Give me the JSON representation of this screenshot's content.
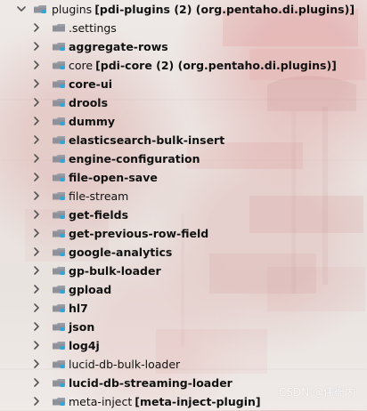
{
  "tree": {
    "root": {
      "name": "plugins",
      "suffix": "[pdi-plugins (2) (org.pentaho.di.plugins)]",
      "icon": "folder-icon",
      "expanded": true
    },
    "items": [
      {
        "name": ".settings",
        "suffix": "",
        "bold": false
      },
      {
        "name": "aggregate-rows",
        "suffix": "",
        "bold": true
      },
      {
        "name": "core",
        "suffix": "[pdi-core (2) (org.pentaho.di.plugins)]",
        "bold": false
      },
      {
        "name": "core-ui",
        "suffix": "",
        "bold": true
      },
      {
        "name": "drools",
        "suffix": "",
        "bold": true
      },
      {
        "name": "dummy",
        "suffix": "",
        "bold": true
      },
      {
        "name": "elasticsearch-bulk-insert",
        "suffix": "",
        "bold": true
      },
      {
        "name": "engine-configuration",
        "suffix": "",
        "bold": true
      },
      {
        "name": "file-open-save",
        "suffix": "",
        "bold": true
      },
      {
        "name": "file-stream",
        "suffix": "",
        "bold": false
      },
      {
        "name": "get-fields",
        "suffix": "",
        "bold": true
      },
      {
        "name": "get-previous-row-field",
        "suffix": "",
        "bold": true
      },
      {
        "name": "google-analytics",
        "suffix": "",
        "bold": true
      },
      {
        "name": "gp-bulk-loader",
        "suffix": "",
        "bold": true
      },
      {
        "name": "gpload",
        "suffix": "",
        "bold": true
      },
      {
        "name": "hl7",
        "suffix": "",
        "bold": true
      },
      {
        "name": "json",
        "suffix": "",
        "bold": true
      },
      {
        "name": "log4j",
        "suffix": "",
        "bold": true
      },
      {
        "name": "lucid-db-bulk-loader",
        "suffix": "",
        "bold": false
      },
      {
        "name": "lucid-db-streaming-loader",
        "suffix": "",
        "bold": true
      },
      {
        "name": "meta-inject",
        "suffix": "[meta-inject-plugin]",
        "bold": false
      }
    ]
  },
  "watermark": "CSDN @伟衙内",
  "colors": {
    "folder": "#9b9ea6",
    "folder_dark": "#7f838c",
    "badge": "#31a7d8",
    "text": "#111111",
    "arrow": "#555555",
    "watermark": "#ffffff"
  }
}
